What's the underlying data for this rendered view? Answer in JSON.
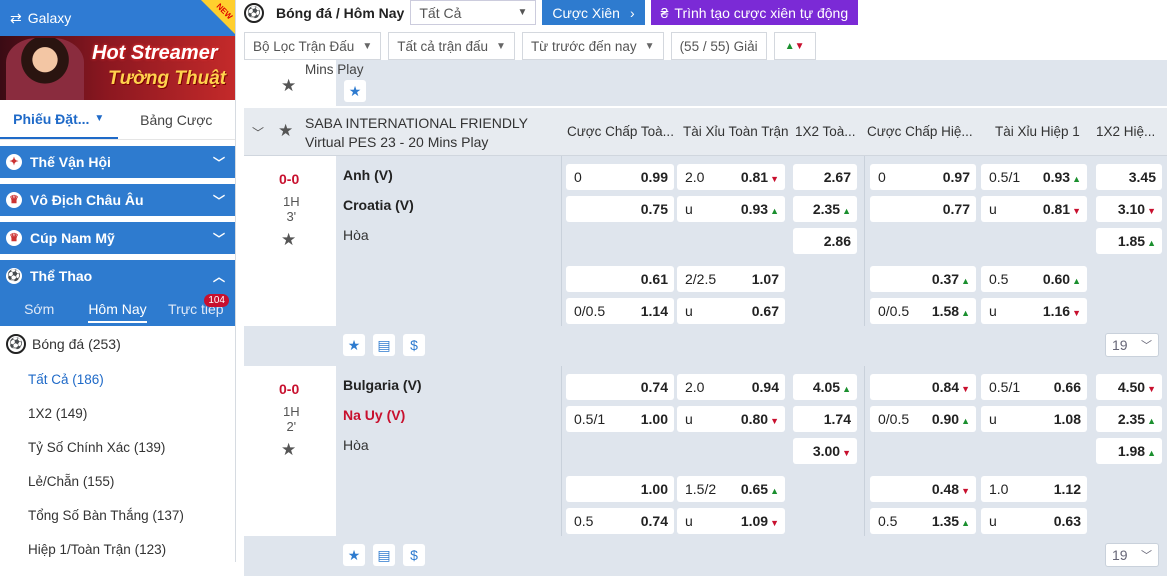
{
  "sidebar": {
    "galaxy_label": "Galaxy",
    "new_tag": "NEW",
    "banner": {
      "line1": "Hot Streamer",
      "line2": "Tường Thuật"
    },
    "tabs": [
      "Phiếu Đặt...",
      "Bảng Cược"
    ],
    "categories": [
      "Thế Vận Hội",
      "Vô Địch Châu Âu",
      "Cúp Nam Mỹ",
      "Thể Thao"
    ],
    "subtabs": [
      "Sớm",
      "Hôm Nay",
      "Trực tiếp"
    ],
    "live_badge": "104",
    "sport": "Bóng đá",
    "sport_count": "(253)",
    "markets": [
      {
        "name": "Tất Cả",
        "count": "(186)"
      },
      {
        "name": "1X2",
        "count": "(149)"
      },
      {
        "name": "Tỷ Số Chính Xác",
        "count": "(139)"
      },
      {
        "name": "Lẻ/Chẵn",
        "count": "(155)"
      },
      {
        "name": "Tổng Số Bàn Thắng",
        "count": "(137)"
      },
      {
        "name": "Hiệp 1/Toàn Trận",
        "count": "(123)"
      }
    ]
  },
  "topbar": {
    "title": "Bóng đá / Hôm Nay",
    "select": "Tất Cả",
    "parlay": "Cược Xiên",
    "builder": "Trình tạo cược xiên tự động"
  },
  "filters": {
    "f1": "Bộ Lọc Trận Đấu",
    "f2": "Tất cả trận đấu",
    "f3": "Từ trước đến nay",
    "f4": "(55 / 55) Giải"
  },
  "prev_text": "Mins Play",
  "league": {
    "name": "SABA INTERNATIONAL FRIENDLY Virtual PES 23 - 20 Mins Play",
    "headers": [
      "Cược Chấp Toà...",
      "Tài Xỉu Toàn Trận",
      "1X2 Toà...",
      "Cược Chấp Hiệ...",
      "Tài Xỉu Hiệp 1",
      "1X2 Hiệ..."
    ]
  },
  "matches": [
    {
      "score": "0-0",
      "half": "1H",
      "minute": "3'",
      "home": "Anh (V)",
      "away": "Croatia (V)",
      "draw": "Hòa",
      "more": "19",
      "rows": [
        {
          "ftah": [
            "0",
            "0.99"
          ],
          "ftou": [
            "2.0",
            "0.81"
          ],
          "ft1x2": "2.67",
          "htah": [
            "0",
            "0.97"
          ],
          "htou": [
            "0.5/1",
            "0.93"
          ],
          "ht1x2": "3.45"
        },
        {
          "ftah": [
            "",
            "0.75"
          ],
          "ftou": [
            "u",
            "0.93"
          ],
          "ft1x2": "2.35",
          "htah": [
            "",
            "0.77"
          ],
          "htou": [
            "u",
            "0.81"
          ],
          "ht1x2": "3.10"
        },
        {
          "ft1x2": "2.86",
          "ht1x2": "1.85"
        },
        {
          "ftah": [
            "",
            "0.61"
          ],
          "ftou": [
            "2/2.5",
            "1.07"
          ],
          "htah": [
            "",
            "0.37"
          ],
          "htou": [
            "0.5",
            "0.60"
          ]
        },
        {
          "ftah": [
            "0/0.5",
            "1.14"
          ],
          "ftou": [
            "u",
            "0.67"
          ],
          "htah": [
            "0/0.5",
            "1.58"
          ],
          "htou": [
            "u",
            "1.16"
          ]
        }
      ]
    },
    {
      "score": "0-0",
      "half": "1H",
      "minute": "2'",
      "home": "Bulgaria (V)",
      "away": "Na Uy (V)",
      "draw": "Hòa",
      "more": "19",
      "rows": [
        {
          "ftah": [
            "",
            "0.74"
          ],
          "ftou": [
            "2.0",
            "0.94"
          ],
          "ft1x2": "4.05",
          "htah": [
            "",
            "0.84"
          ],
          "htou": [
            "0.5/1",
            "0.66"
          ],
          "ht1x2": "4.50"
        },
        {
          "ftah": [
            "0.5/1",
            "1.00"
          ],
          "ftou": [
            "u",
            "0.80"
          ],
          "ft1x2": "1.74",
          "htah": [
            "0/0.5",
            "0.90"
          ],
          "htou": [
            "u",
            "1.08"
          ],
          "ht1x2": "2.35"
        },
        {
          "ft1x2": "3.00",
          "ht1x2": "1.98"
        },
        {
          "ftah": [
            "",
            "1.00"
          ],
          "ftou": [
            "1.5/2",
            "0.65"
          ],
          "htah": [
            "",
            "0.48"
          ],
          "htou": [
            "1.0",
            "1.12"
          ]
        },
        {
          "ftah": [
            "0.5",
            "0.74"
          ],
          "ftou": [
            "u",
            "1.09"
          ],
          "htah": [
            "0.5",
            "1.35"
          ],
          "htou": [
            "u",
            "0.63"
          ]
        }
      ]
    }
  ]
}
